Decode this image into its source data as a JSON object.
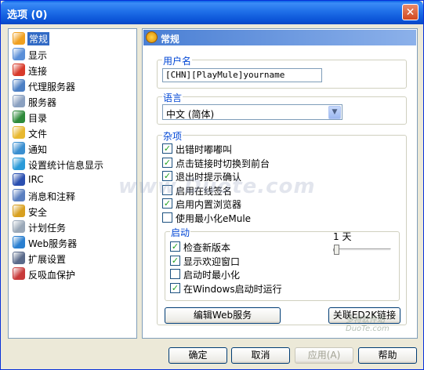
{
  "window": {
    "title": "选项 (0)",
    "close_glyph": "✕"
  },
  "sidebar": {
    "items": [
      {
        "label": "常规",
        "icon": "gear-icon",
        "color": "#f0a020",
        "selected": true
      },
      {
        "label": "显示",
        "icon": "display-icon",
        "color": "#5a8fd8"
      },
      {
        "label": "连接",
        "icon": "connection-icon",
        "color": "#d83a2a"
      },
      {
        "label": "代理服务器",
        "icon": "proxy-icon",
        "color": "#4c7fc4"
      },
      {
        "label": "服务器",
        "icon": "server-icon",
        "color": "#8aa0c0"
      },
      {
        "label": "目录",
        "icon": "folder-icon",
        "color": "#2e8a3a"
      },
      {
        "label": "文件",
        "icon": "file-icon",
        "color": "#e8b830"
      },
      {
        "label": "通知",
        "icon": "notification-icon",
        "color": "#3a8fd0"
      },
      {
        "label": "设置统计信息显示",
        "icon": "statistics-icon",
        "color": "#2a9ad8"
      },
      {
        "label": "IRC",
        "icon": "irc-icon",
        "color": "#2a4fb0"
      },
      {
        "label": "消息和注释",
        "icon": "message-icon",
        "color": "#5a7fc0"
      },
      {
        "label": "安全",
        "icon": "lock-icon",
        "color": "#d8a020"
      },
      {
        "label": "计划任务",
        "icon": "calendar-icon",
        "color": "#9aa8b8"
      },
      {
        "label": "Web服务器",
        "icon": "globe-icon",
        "color": "#2a7fd0"
      },
      {
        "label": "扩展设置",
        "icon": "extended-settings-icon",
        "color": "#5a6a8a"
      },
      {
        "label": "反吸血保护",
        "icon": "protection-icon",
        "color": "#c83a3a"
      }
    ]
  },
  "panel": {
    "header": "常规",
    "username": {
      "label": "用户名",
      "value": "[CHN][PlayMule]yourname"
    },
    "language": {
      "label": "语言",
      "value": "中文 (简体)"
    },
    "misc": {
      "label": "杂项",
      "options": [
        {
          "label": "出错时嘟嘟叫",
          "checked": true
        },
        {
          "label": "点击链接时切换到前台",
          "checked": true
        },
        {
          "label": "退出时提示确认",
          "checked": true
        },
        {
          "label": "启用在线签名",
          "checked": false
        },
        {
          "label": "启用内置浏览器",
          "checked": true
        },
        {
          "label": "使用最小化eMule",
          "checked": false
        }
      ]
    },
    "startup": {
      "label": "启动",
      "options": [
        {
          "label": "检查新版本",
          "checked": true
        },
        {
          "label": "显示欢迎窗口",
          "checked": true
        },
        {
          "label": "启动时最小化",
          "checked": false
        },
        {
          "label": "在Windows启动时运行",
          "checked": true
        }
      ],
      "interval_label": "1 天",
      "interval_days": 1
    },
    "edit_web_button": "编辑Web服务",
    "assoc_ed2k_button": "关联ED2K链接"
  },
  "footer": {
    "ok": "确定",
    "cancel": "取消",
    "apply": "应用(A)",
    "help": "帮助"
  },
  "watermark": "www.Duote.com",
  "watermark_logo": "多特软件站 DuoTe.com"
}
